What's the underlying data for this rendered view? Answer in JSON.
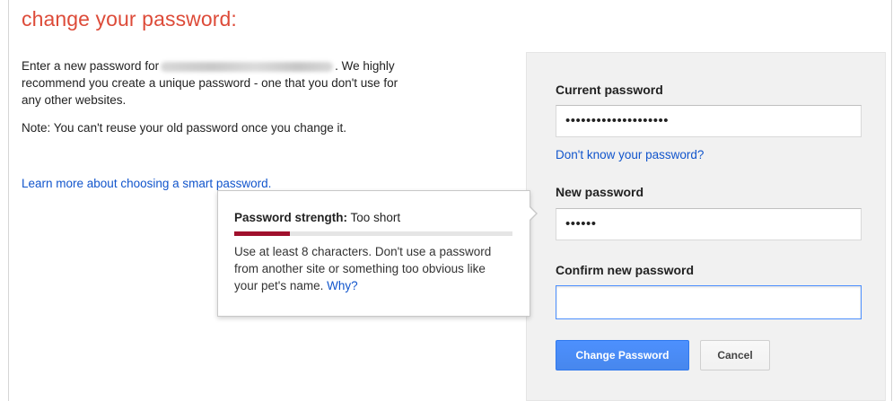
{
  "page": {
    "title": "change your password:",
    "intro_before": "Enter a new password for",
    "intro_after": ". We highly recommend you create a unique password - one that you don't use for any other websites.",
    "note": "Note: You can't reuse your old password once you change it.",
    "learn_more_link": "Learn more about choosing a smart password."
  },
  "form": {
    "current_password_label": "Current password",
    "current_password_value": "••••••••••••••••••••",
    "forgot_link": "Don't know your password?",
    "new_password_label": "New password",
    "new_password_value": "••••••",
    "confirm_password_label": "Confirm new password",
    "confirm_password_value": "",
    "change_button": "Change Password",
    "cancel_button": "Cancel"
  },
  "tooltip": {
    "strength_label": "Password strength:",
    "strength_value": "Too short",
    "strength_fraction": 0.2,
    "meter_color": "#a0102d",
    "advice": "Use at least 8 characters. Don't use a password from another site or something too obvious like your pet's name.",
    "why_link": "Why?"
  },
  "colors": {
    "title": "#dd4b39",
    "link": "#1155cc",
    "primary_button": "#4d90fe",
    "panel_background": "#f1f1f1"
  }
}
